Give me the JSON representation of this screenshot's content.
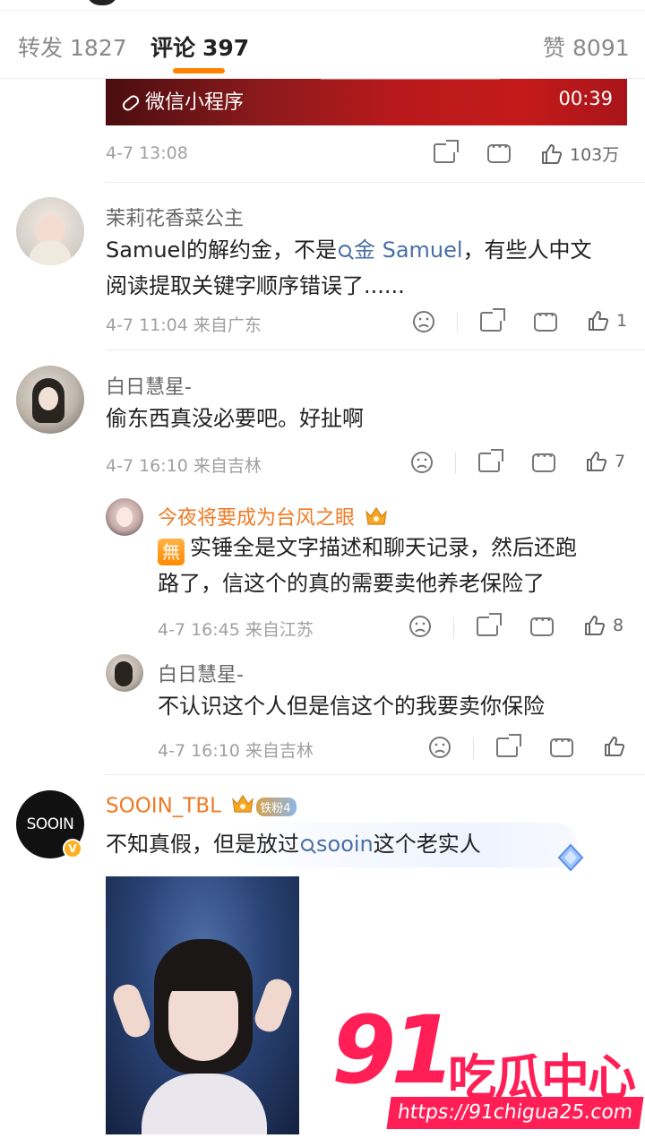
{
  "tabs": {
    "repost_label": "转发",
    "repost_count": "1827",
    "comment_label": "评论",
    "comment_count": "397",
    "like_label": "赞",
    "like_count": "8091"
  },
  "video": {
    "miniapp_label": "微信小程序",
    "duration": "00:39"
  },
  "post_meta": {
    "time": "4-7 13:08",
    "likes": "103万"
  },
  "comments": [
    {
      "name": "茉莉花香菜公主",
      "text_a": "Samuel的解约金，不是",
      "keyword": "金 Samuel",
      "text_b": "，有些人中文",
      "text_c": "阅读提取关键字顺序错误了......",
      "meta": "4-7 11:04 来自广东",
      "likes": "1"
    },
    {
      "name": "白日慧星-",
      "text": "偷东西真没必要吧。好扯啊",
      "meta": "4-7 16:10 来自吉林",
      "likes": "7",
      "replies": [
        {
          "name": "今夜将要成为台风之眼",
          "badge": "無",
          "text_line1": "实锤全是文字描述和聊天记录，然后还跑",
          "text_line2": "路了，信这个的真的需要卖他养老保险了",
          "meta": "4-7 16:45 来自江苏",
          "likes": "8"
        },
        {
          "name": "白日慧星-",
          "text": "不认识这个人但是信这个的我要卖你保险",
          "meta": "4-7 16:10 来自吉林"
        }
      ]
    },
    {
      "name": "SOOIN_TBL",
      "fan_badge": "铁粉4",
      "avatar_text": "SOOIN",
      "text_a": "不知真假，但是放过",
      "keyword": "sooin",
      "text_b": "这个老实人"
    }
  ],
  "watermark": {
    "number": "91",
    "name": "吃瓜中心",
    "url": "https://91chigua25.com"
  },
  "colors": {
    "accent": "#ff8200",
    "orange_name": "#f07a24",
    "keyword": "#4a6fa5",
    "watermark": "#ff1f56"
  }
}
